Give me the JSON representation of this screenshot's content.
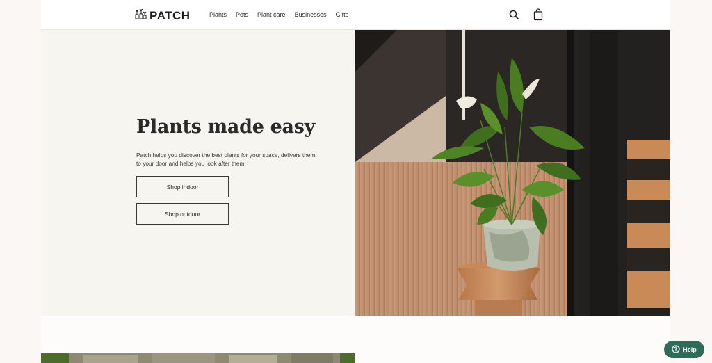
{
  "header": {
    "logo_text": "PATCH",
    "nav": [
      "Plants",
      "Pots",
      "Plant care",
      "Businesses",
      "Gifts"
    ],
    "icons": [
      "search-icon",
      "bag-icon"
    ]
  },
  "hero": {
    "title": "Plants made easy",
    "description": "Patch helps you discover the best plants for your space, delivers them to your door and helps you look after them.",
    "buttons": [
      "Shop indoor",
      "Shop outdoor"
    ]
  },
  "help": {
    "label": "Help",
    "icon": "help-circle-icon"
  },
  "colors": {
    "accent": "#2e6b58",
    "hero_bg": "#f7f5ef",
    "page_bg": "#fbf7f4"
  }
}
